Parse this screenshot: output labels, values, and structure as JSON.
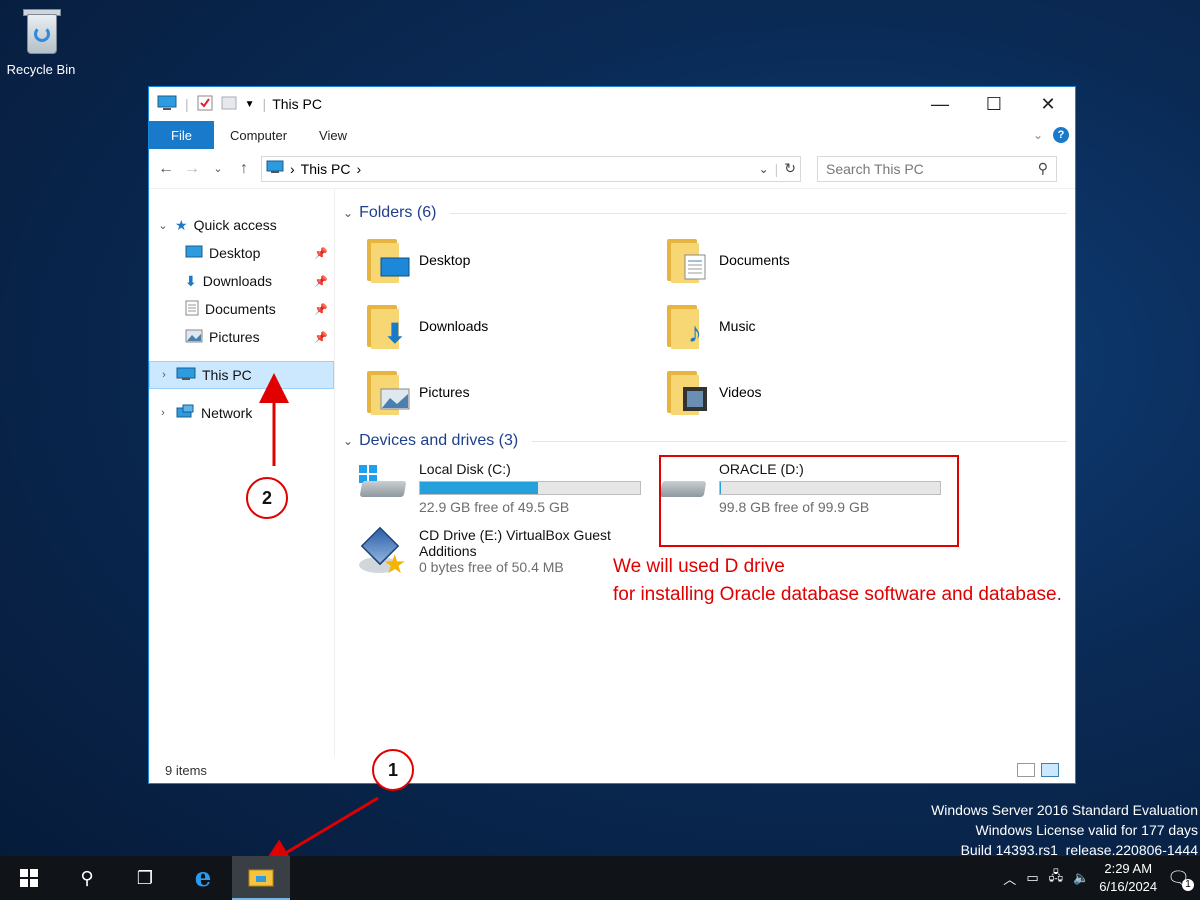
{
  "desktop": {
    "recycle_bin": "Recycle Bin"
  },
  "window": {
    "title": "This PC",
    "controls": {
      "minimize": "—",
      "maximize": "☐",
      "close": "✕"
    },
    "ribbon": {
      "file": "File",
      "computer": "Computer",
      "view": "View"
    },
    "address": {
      "path_item": "This PC",
      "separator": "›"
    },
    "search": {
      "placeholder": "Search This PC"
    },
    "nav": {
      "quick_access": "Quick access",
      "items": [
        {
          "label": "Desktop",
          "icon": "desktop-icon"
        },
        {
          "label": "Downloads",
          "icon": "download-icon"
        },
        {
          "label": "Documents",
          "icon": "document-icon"
        },
        {
          "label": "Pictures",
          "icon": "pictures-icon"
        }
      ],
      "this_pc": "This PC",
      "network": "Network"
    },
    "folders": {
      "header": "Folders (6)",
      "items": [
        "Desktop",
        "Documents",
        "Downloads",
        "Music",
        "Pictures",
        "Videos"
      ]
    },
    "drives": {
      "header": "Devices and drives (3)",
      "c": {
        "name": "Local Disk (C:)",
        "free": "22.9 GB free of 49.5 GB",
        "used_fraction": 0.537
      },
      "d": {
        "name": "ORACLE (D:)",
        "free": "99.8 GB free of 99.9 GB",
        "used_fraction": 0.001
      },
      "e": {
        "name_line1": "CD Drive (E:) VirtualBox Guest",
        "name_line2": "Additions",
        "free": "0 bytes free of 50.4 MB"
      }
    },
    "status": {
      "items": "9 items"
    }
  },
  "annotation": {
    "note_line1": "We will used D drive",
    "note_line2": "for installing Oracle database software and database.",
    "callout1": "1",
    "callout2": "2",
    "color": "#e00000"
  },
  "watermark": {
    "line1": "Windows Server 2016 Standard Evaluation",
    "line2": "Windows License valid for 177 days",
    "line3": "Build 14393.rs1_release.220806-1444"
  },
  "taskbar": {
    "time": "2:29 AM",
    "date": "6/16/2024",
    "notifications": "1"
  }
}
